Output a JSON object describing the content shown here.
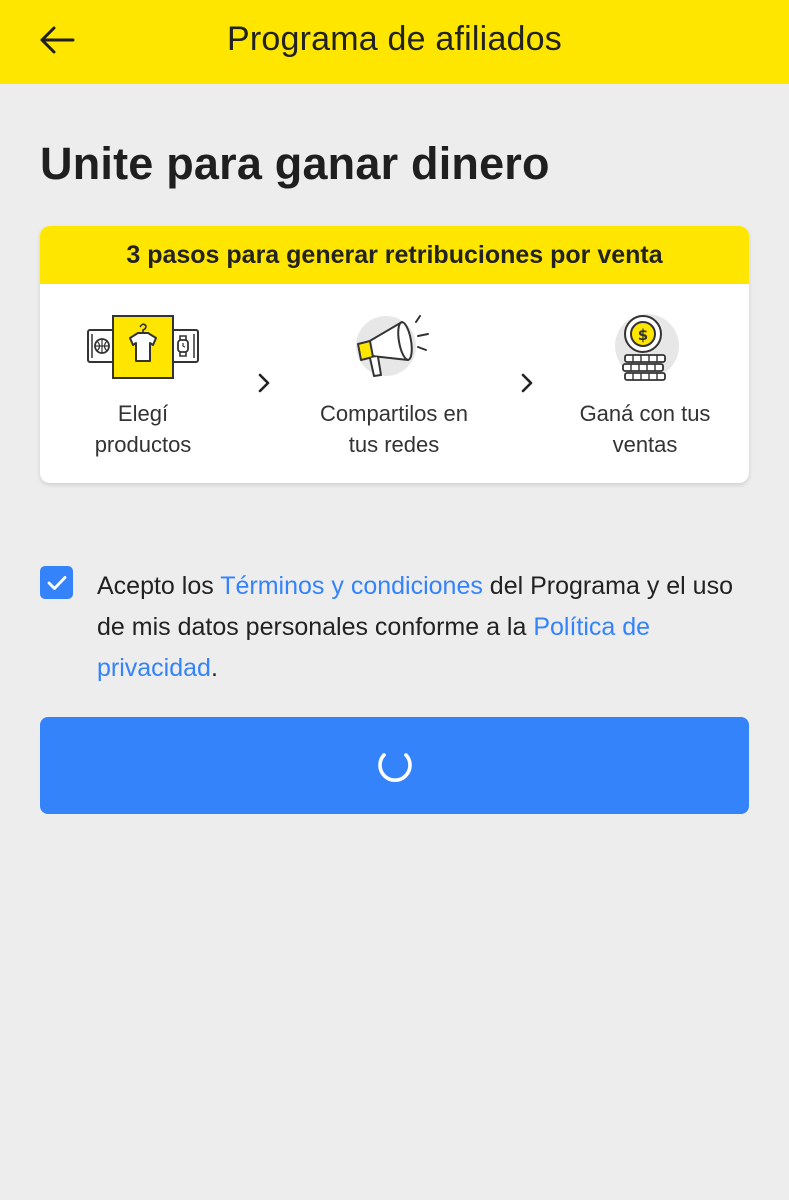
{
  "header": {
    "title": "Programa de afiliados",
    "back_icon": "arrow-left-icon",
    "background_color": "#ffe600"
  },
  "page": {
    "title": "Unite para ganar dinero"
  },
  "steps_card": {
    "header": "3 pasos para generar retribuciones por venta",
    "steps": [
      {
        "line1": "Elegí",
        "line2": "productos",
        "icon": "product-selection-icon"
      },
      {
        "line1": "Compartilos en",
        "line2": "tus redes",
        "icon": "megaphone-icon"
      },
      {
        "line1": "Ganá con tus",
        "line2": "ventas",
        "icon": "coins-icon"
      }
    ],
    "separator_icon": "chevron-right-icon"
  },
  "consent": {
    "checked": true,
    "text_before": "Acepto los ",
    "terms_link": "Términos y condiciones",
    "text_middle": " del Programa y el uso de mis datos personales conforme a la ",
    "privacy_link": "Política de privacidad",
    "text_after": "."
  },
  "primary_button": {
    "state": "loading",
    "icon": "loading-spinner-icon"
  },
  "colors": {
    "accent_yellow": "#ffe600",
    "primary_blue": "#3483fa",
    "background": "#ededed"
  }
}
